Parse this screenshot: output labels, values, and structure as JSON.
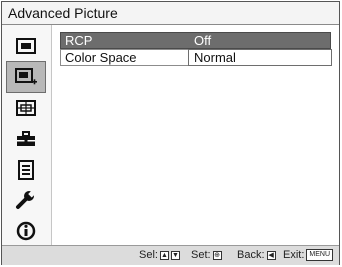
{
  "window": {
    "title": "Advanced Picture"
  },
  "sidebar": {
    "items": [
      {
        "icon": "picture-icon",
        "selected": false
      },
      {
        "icon": "advanced-picture-icon",
        "selected": true
      },
      {
        "icon": "screen-icon",
        "selected": false
      },
      {
        "icon": "setup-icon",
        "selected": false
      },
      {
        "icon": "function-icon",
        "selected": false
      },
      {
        "icon": "installation-wrench-icon",
        "selected": false
      },
      {
        "icon": "information-icon",
        "selected": false
      }
    ]
  },
  "settings": {
    "rows": [
      {
        "label": "RCP",
        "value": "Off",
        "selected": true
      },
      {
        "label": "Color Space",
        "value": "Normal",
        "selected": false
      }
    ]
  },
  "footer": {
    "sel_label": "Sel:",
    "set_label": "Set:",
    "back_label": "Back:",
    "exit_label": "Exit:",
    "menu_key": "MENU"
  }
}
